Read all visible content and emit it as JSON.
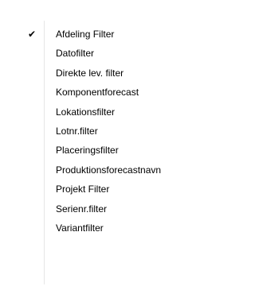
{
  "menu": {
    "items": [
      {
        "label": "Afdeling Filter",
        "checked": true,
        "check_glyph": "✔"
      },
      {
        "label": "Datofilter",
        "checked": false,
        "check_glyph": ""
      },
      {
        "label": "Direkte lev. filter",
        "checked": false,
        "check_glyph": ""
      },
      {
        "label": "Komponentforecast",
        "checked": false,
        "check_glyph": ""
      },
      {
        "label": "Lokationsfilter",
        "checked": false,
        "check_glyph": ""
      },
      {
        "label": "Lotnr.filter",
        "checked": false,
        "check_glyph": ""
      },
      {
        "label": "Placeringsfilter",
        "checked": false,
        "check_glyph": ""
      },
      {
        "label": "Produktionsforecastnavn",
        "checked": false,
        "check_glyph": ""
      },
      {
        "label": "Projekt Filter",
        "checked": false,
        "check_glyph": ""
      },
      {
        "label": "Serienr.filter",
        "checked": false,
        "check_glyph": ""
      },
      {
        "label": "Variantfilter",
        "checked": false,
        "check_glyph": ""
      }
    ]
  }
}
